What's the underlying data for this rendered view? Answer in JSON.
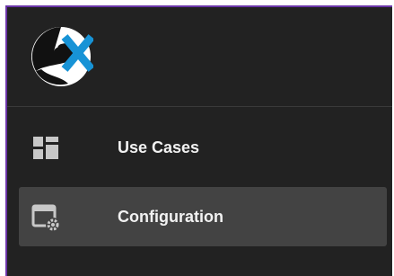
{
  "sidebar": {
    "logo_icon": "sx-brand-logo",
    "accent_color": "#6b35a8",
    "items": [
      {
        "label": "Use Cases",
        "icon": "dashboard-grid-icon",
        "active": false
      },
      {
        "label": "Configuration",
        "icon": "settings-window-icon",
        "active": true
      }
    ]
  },
  "colors": {
    "panel_bg": "#222222",
    "active_item_bg": "#434343",
    "logo_blue": "#1793d6",
    "icon_gray": "#c8c8c8"
  }
}
